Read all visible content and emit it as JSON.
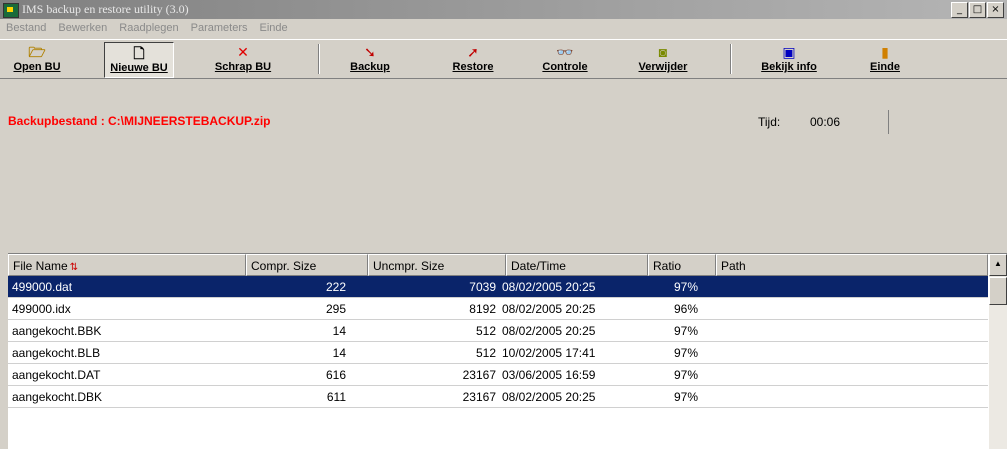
{
  "window": {
    "title": "IMS backup en restore utility (3.0)",
    "controls": [
      "_",
      "□",
      "×"
    ]
  },
  "menu": [
    "Bestand",
    "Bewerken",
    "Raadplegen",
    "Parameters",
    "Einde"
  ],
  "toolbar": [
    {
      "label": "Open BU",
      "icon": "open-folder-icon",
      "glyph": "🗁",
      "color": "#b08000"
    },
    {
      "label": "Nieuwe BU",
      "icon": "new-document-icon",
      "glyph": "🗋",
      "color": "#000000",
      "pressed": true
    },
    {
      "label": "Schrap BU",
      "icon": "delete-x-icon",
      "glyph": "✕",
      "color": "#e00000"
    },
    {
      "label": "Backup",
      "icon": "backup-arrow-icon",
      "glyph": "➘",
      "color": "#c00000"
    },
    {
      "label": "Restore",
      "icon": "restore-arrow-icon",
      "glyph": "➚",
      "color": "#c00000"
    },
    {
      "label": "Controle",
      "icon": "binoculars-icon",
      "glyph": "👓",
      "color": "#000000"
    },
    {
      "label": "Verwijder",
      "icon": "remove-icon",
      "glyph": "◙",
      "color": "#7a8a00"
    },
    {
      "label": "Bekijk info",
      "icon": "info-icon",
      "glyph": "▣",
      "color": "#0000c0"
    },
    {
      "label": "Einde",
      "icon": "exit-door-icon",
      "glyph": "▮",
      "color": "#d08000"
    }
  ],
  "info": {
    "backup_file": "Backupbestand : C:\\MIJNEERSTEBACKUP.zip",
    "tijd_label": "Tijd:",
    "tijd_value": "00:06"
  },
  "table": {
    "columns": [
      "File Name",
      "Compr. Size",
      "Uncmpr. Size",
      "Date/Time",
      "Ratio",
      "Path"
    ],
    "rows": [
      [
        "499000.dat",
        "222",
        "7039",
        "08/02/2005  20:25",
        "97%",
        ""
      ],
      [
        "499000.idx",
        "295",
        "8192",
        "08/02/2005  20:25",
        "96%",
        ""
      ],
      [
        "aangekocht.BBK",
        "14",
        "512",
        "08/02/2005  20:25",
        "97%",
        ""
      ],
      [
        "aangekocht.BLB",
        "14",
        "512",
        "10/02/2005  17:41",
        "97%",
        ""
      ],
      [
        "aangekocht.DAT",
        "616",
        "23167",
        "03/06/2005  16:59",
        "97%",
        ""
      ],
      [
        "aangekocht.DBK",
        "611",
        "23167",
        "08/02/2005  20:25",
        "97%",
        ""
      ]
    ],
    "selected_row": 0
  }
}
